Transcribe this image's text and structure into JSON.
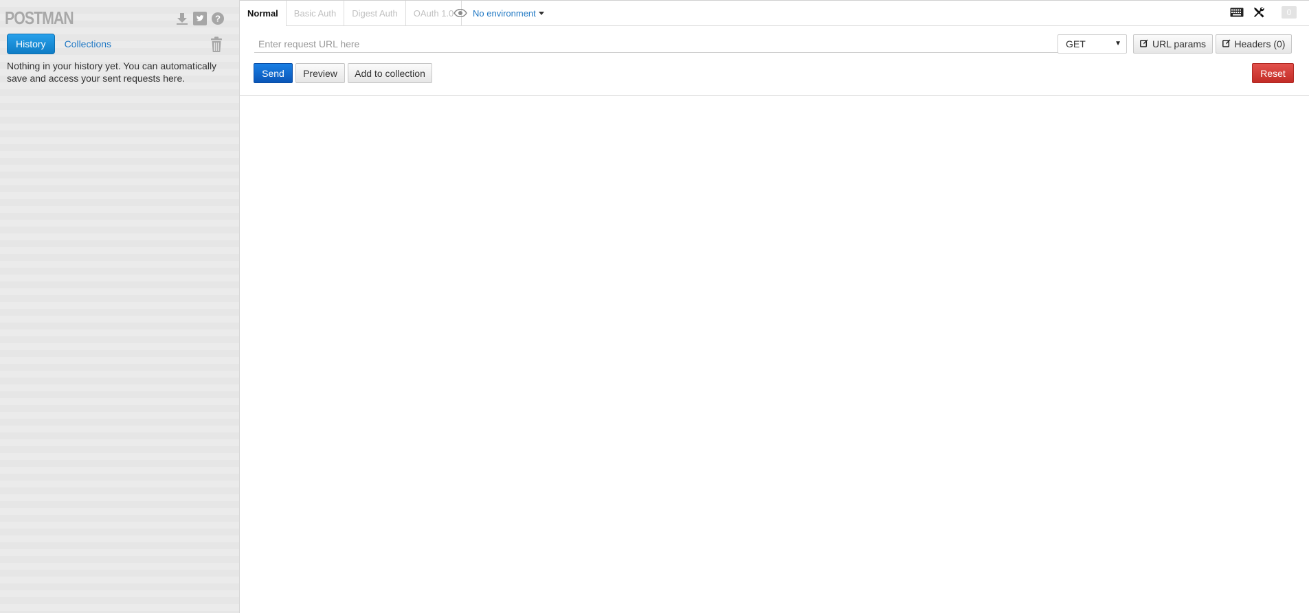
{
  "sidebar": {
    "logo": "POSTMAN",
    "header_icons": [
      "download-icon",
      "twitter-icon",
      "help-icon"
    ],
    "tabs": [
      {
        "label": "History",
        "active": true
      },
      {
        "label": "Collections",
        "active": false
      }
    ],
    "trash_icon": "trash-icon",
    "empty_message": "Nothing in your history yet. You can automatically save and access your sent requests here."
  },
  "main": {
    "auth_tabs": [
      {
        "label": "Normal",
        "active": true
      },
      {
        "label": "Basic Auth",
        "active": false
      },
      {
        "label": "Digest Auth",
        "active": false
      },
      {
        "label": "OAuth 1.0",
        "active": false
      }
    ],
    "environment": {
      "icon": "eye-icon",
      "label": "No environment"
    },
    "top_right": {
      "icons": [
        "keyboard-icon",
        "tools-icon"
      ],
      "count": "0"
    },
    "url": {
      "placeholder": "Enter request URL here",
      "value": ""
    },
    "method": {
      "selected": "GET"
    },
    "buttons": {
      "url_params": "URL params",
      "headers": "Headers (0)",
      "send": "Send",
      "preview": "Preview",
      "add_to_collection": "Add to collection",
      "reset": "Reset"
    }
  },
  "colors": {
    "accent": "#1a8cd8",
    "link": "#1e77c3",
    "send": "#0a56b8",
    "reset": "#c22c26",
    "sidebar_bg": "#e9e9e9"
  }
}
